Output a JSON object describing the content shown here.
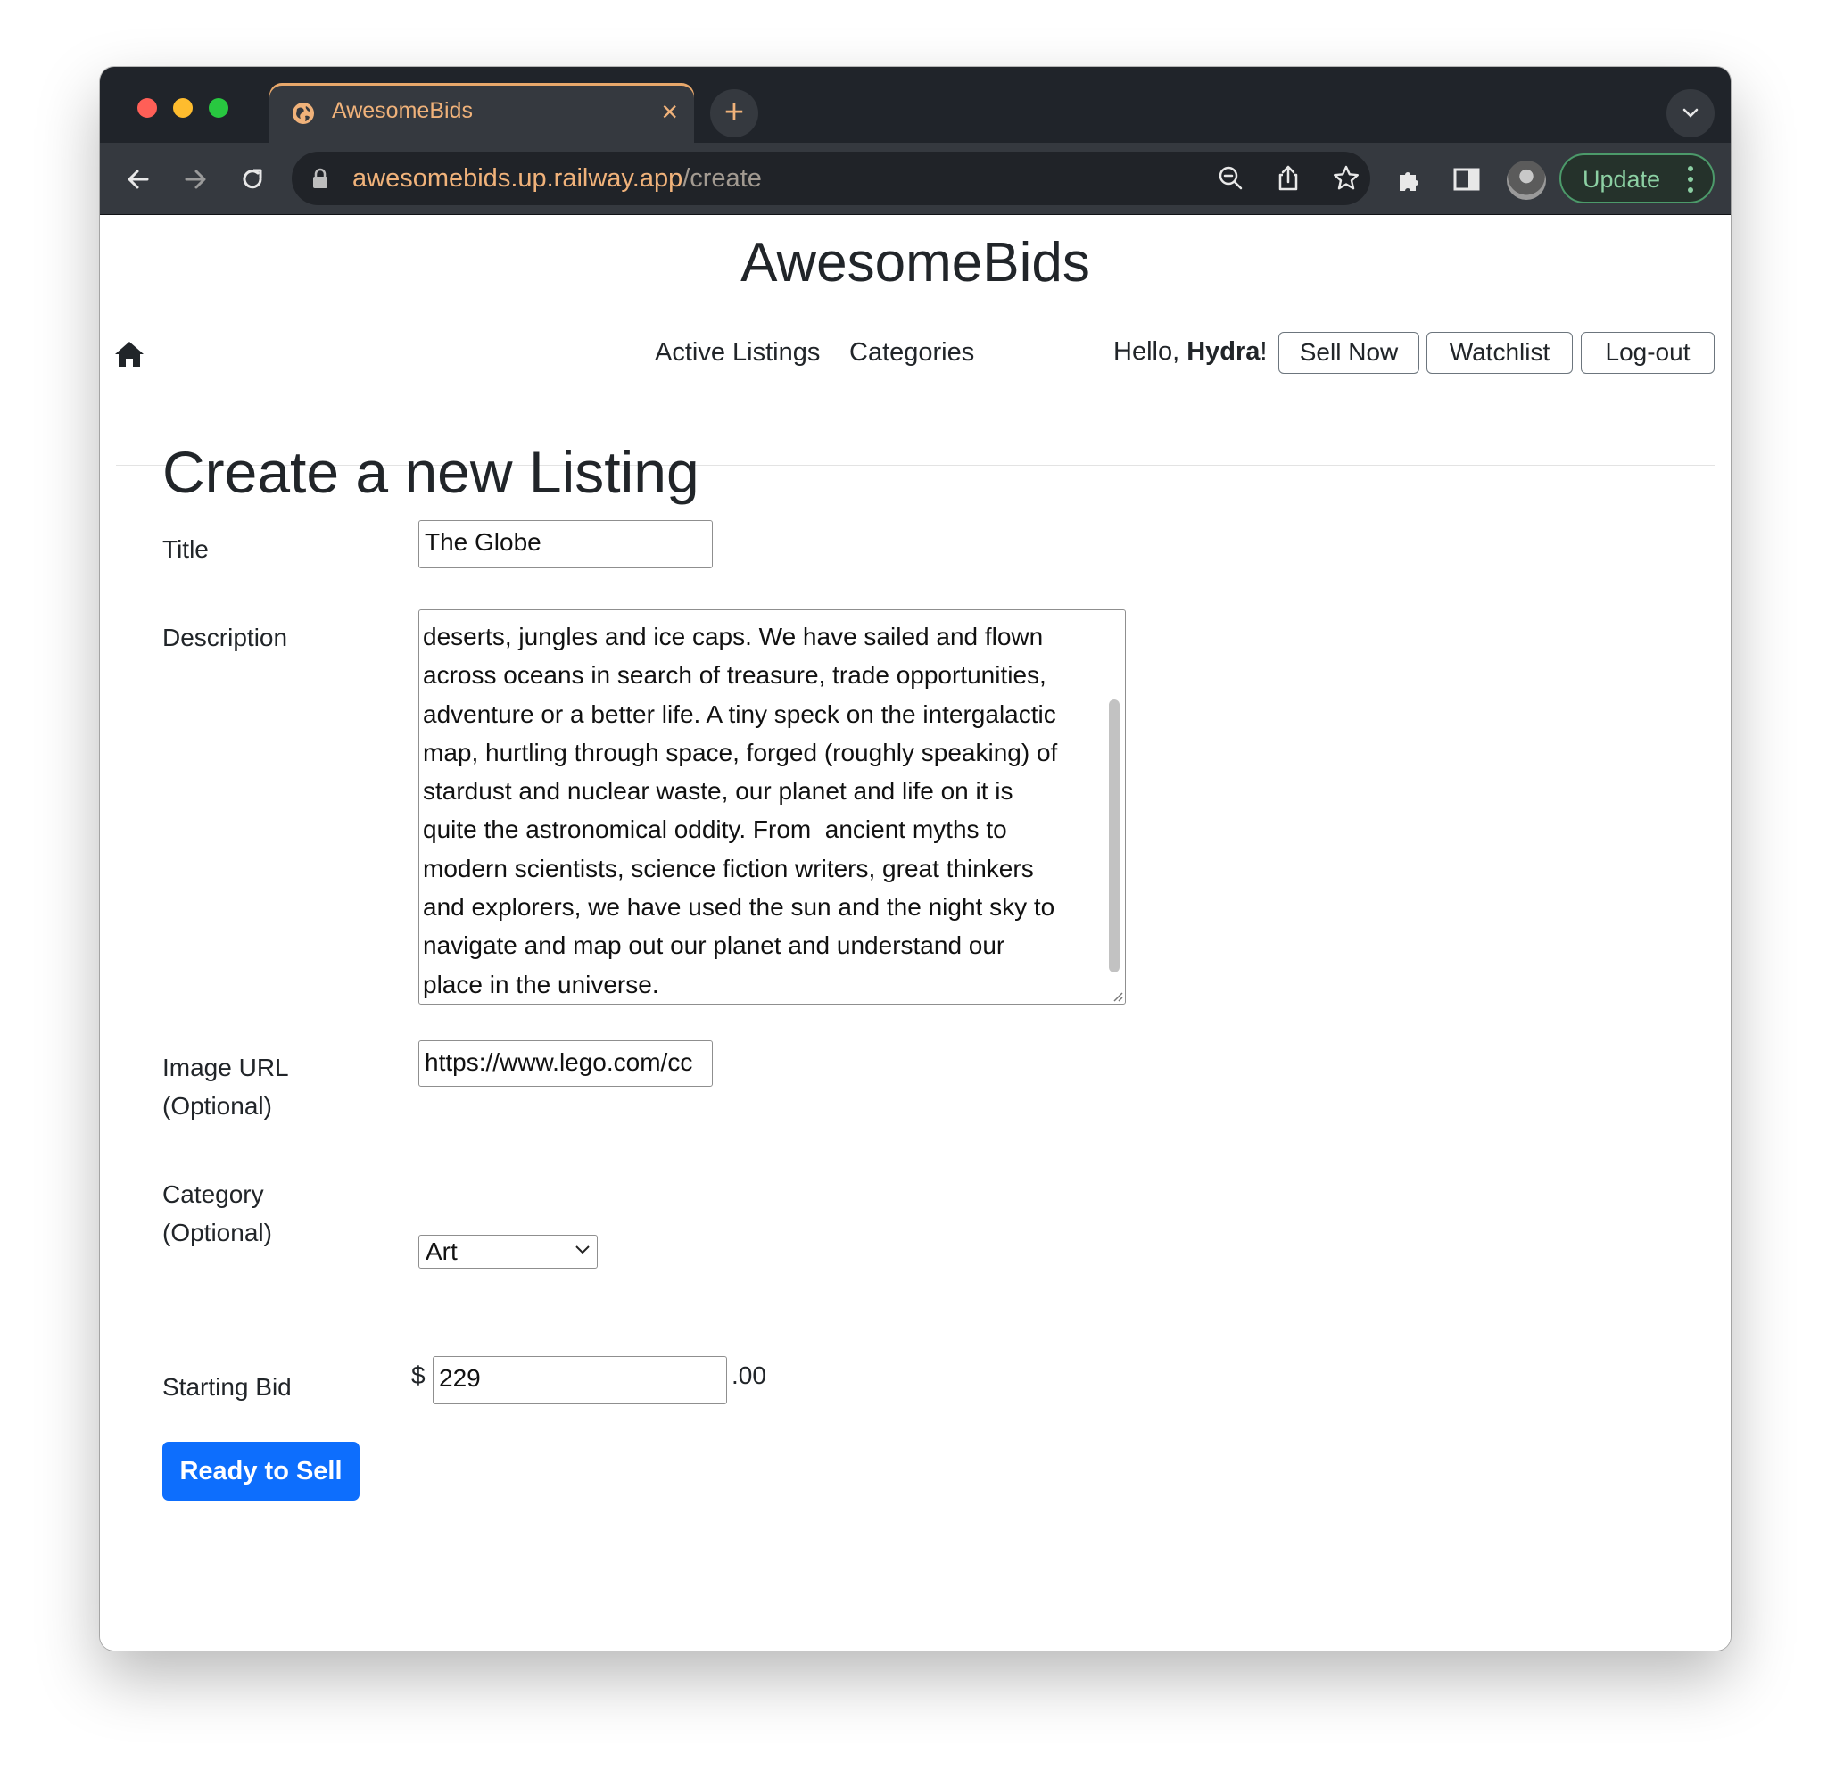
{
  "browser": {
    "tab_title": "AwesomeBids",
    "tab_close": "×",
    "new_tab": "+",
    "url_host": "awesomebids.up.railway.app",
    "url_path": "/create",
    "update_label": "Update",
    "icons": [
      "back-icon",
      "forward-icon",
      "reload-icon",
      "lock-icon",
      "zoom-icon",
      "share-icon",
      "bookmark-star-icon",
      "extensions-icon",
      "sidebar-icon",
      "profile-avatar",
      "more-icon"
    ]
  },
  "site": {
    "title": "AwesomeBids"
  },
  "nav": {
    "links": [
      "Active Listings",
      "Categories"
    ],
    "greeting_prefix": "Hello, ",
    "username": "Hydra",
    "greeting_suffix": "!",
    "buttons": [
      "Sell Now",
      "Watchlist",
      "Log-out"
    ]
  },
  "form": {
    "heading": "Create a new Listing",
    "title_label": "Title",
    "title_value": "The Globe",
    "description_label": "Description",
    "description_value": "deserts, jungles and ice caps. We have sailed and flown\nacross oceans in search of treasure, trade opportunities,\nadventure or a better life. A tiny speck on the intergalactic\nmap, hurtling through space, forged (roughly speaking) of\nstardust and nuclear waste, our planet and life on it is\nquite the astronomical oddity. From  ancient myths to\nmodern scientists, science fiction writers, great thinkers\nand explorers, we have used the sun and the night sky to\nnavigate and map out our planet and understand our\nplace in the universe.",
    "image_label_1": "Image URL",
    "image_label_2": "(Optional)",
    "image_value": "https://www.lego.com/cc",
    "category_label_1": "Category",
    "category_label_2": "(Optional)",
    "category_value": "Art",
    "bid_label": "Starting Bid",
    "currency_symbol": "$",
    "bid_value": "229",
    "bid_cents": ".00",
    "submit_label": "Ready to Sell"
  },
  "colors": {
    "chrome_dark": "#20242a",
    "chrome_toolbar": "#35393f",
    "accent_orange": "#f0b27a",
    "primary_blue": "#0d6efd"
  }
}
